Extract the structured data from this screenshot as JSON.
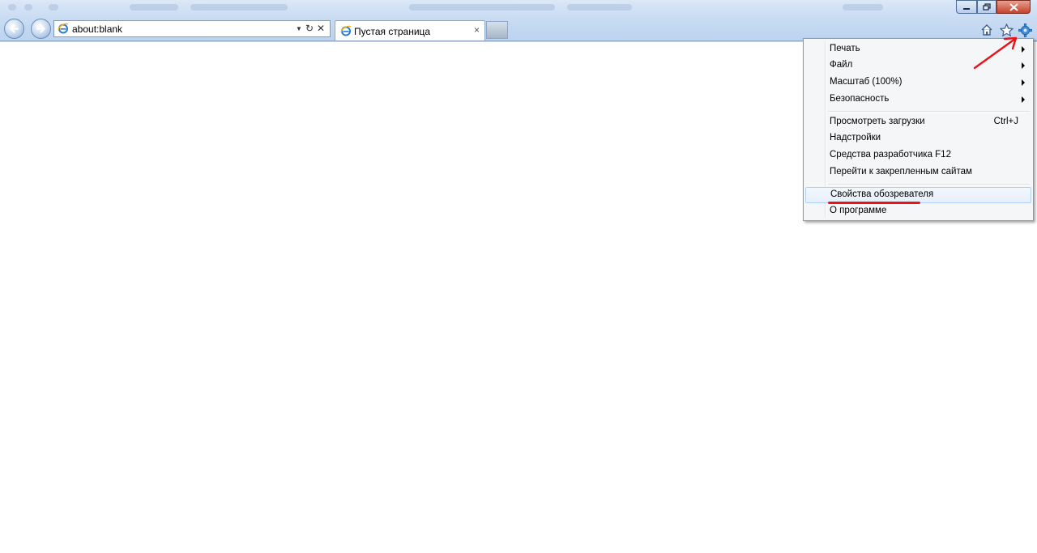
{
  "browser": {
    "address_value": "about:blank",
    "refresh_icon": "refresh-icon",
    "stop_icon": "stop-icon",
    "tab_title": "Пустая страница",
    "tab_close_glyph": "×"
  },
  "tools_menu": {
    "items": [
      {
        "label": "Печать",
        "submenu": true
      },
      {
        "label": "Файл",
        "submenu": true
      },
      {
        "label": "Масштаб (100%)",
        "submenu": true
      },
      {
        "label": "Безопасность",
        "submenu": true
      },
      {
        "label": "Просмотреть загрузки",
        "shortcut": "Ctrl+J"
      },
      {
        "label": "Надстройки"
      },
      {
        "label": "Средства разработчика F12"
      },
      {
        "label": "Перейти к закрепленным сайтам"
      },
      {
        "label": "Свойства обозревателя",
        "highlighted": true
      },
      {
        "label": "О программе"
      }
    ]
  },
  "colors": {
    "annotation_red": "#e8141a",
    "highlight_border": "#aecff7"
  }
}
